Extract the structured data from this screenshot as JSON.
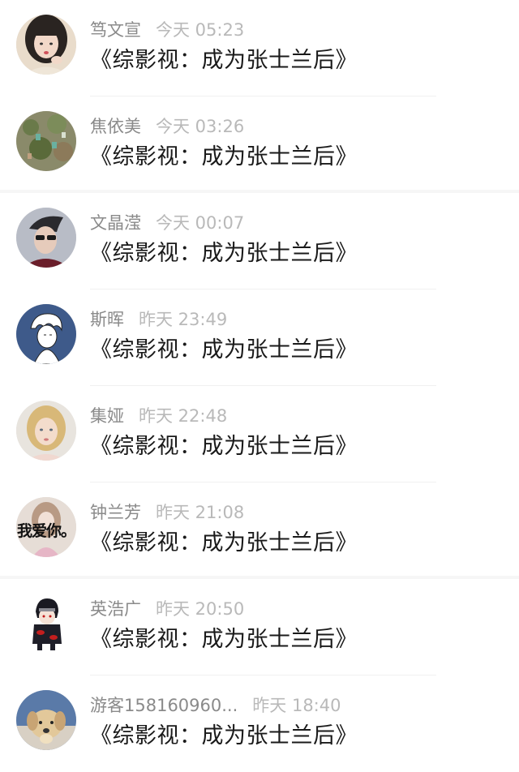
{
  "comments": [
    {
      "name": "笃文宣",
      "time": "今天 05:23",
      "content": "《综影视：成为张士兰后》",
      "avatar": "avatar-girl-photo"
    },
    {
      "name": "焦依美",
      "time": "今天 03:26",
      "content": "《综影视：成为张士兰后》",
      "avatar": "avatar-garden-photo"
    },
    {
      "name": "文晶滢",
      "time": "今天 00:07",
      "content": "《综影视：成为张士兰后》",
      "avatar": "avatar-man-sunglasses"
    },
    {
      "name": "斯晖",
      "time": "昨天 23:49",
      "content": "《综影视：成为张士兰后》",
      "avatar": "avatar-anime-sketch"
    },
    {
      "name": "集娅",
      "time": "昨天 22:48",
      "content": "《综影视：成为张士兰后》",
      "avatar": "avatar-blonde-girl"
    },
    {
      "name": "钟兰芳",
      "time": "昨天 21:08",
      "content": "《综影视：成为张士兰后》",
      "avatar": "avatar-girl-text",
      "avatar_text": "我爱你。"
    },
    {
      "name": "英浩广",
      "time": "昨天 20:50",
      "content": "《综影视：成为张士兰后》",
      "avatar": "avatar-anime-ninja"
    },
    {
      "name": "游客158160960...",
      "time": "昨天 18:40",
      "content": "《综影视：成为张士兰后》",
      "avatar": "avatar-puppy"
    }
  ],
  "colors": {
    "name": "#8a8a8a",
    "time": "#b9b9b9",
    "content": "#1a1a1a",
    "divider": "#f0f0f0"
  }
}
